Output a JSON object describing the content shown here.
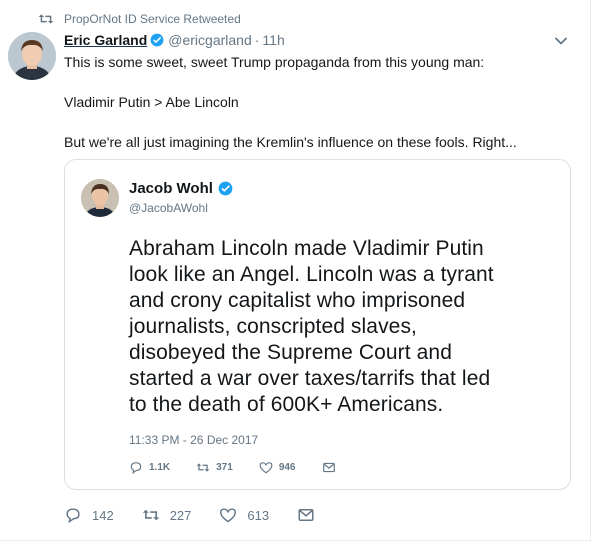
{
  "retweet_context": {
    "text": "PropOrNot ID Service Retweeted",
    "icon": "retweet-icon"
  },
  "tweet": {
    "display_name": "Eric Garland",
    "handle": "@ericgarland",
    "separator": "·",
    "time": "11h",
    "verified_icon": "verified-badge-icon",
    "text_lines": [
      "This is some sweet, sweet Trump propaganda from this young man:",
      "Vladimir Putin > Abe Lincoln",
      "But we're all just imagining the Kremlin's influence on these fools. Right..."
    ]
  },
  "quoted_tweet": {
    "display_name": "Jacob Wohl",
    "handle": "@JacobAWohl",
    "text_lines": [
      "Abraham Lincoln made Vladimir Putin",
      "look like an Angel. Lincoln was a tyrant",
      "and crony capitalist who imprisoned",
      "journalists, conscripted slaves,",
      "disobeyed the Supreme Court and",
      "started a war over taxes/tarrifs that led",
      "to the death of 600K+ Americans."
    ],
    "timestamp": "11:33 PM - 26 Dec 2017",
    "actions": {
      "reply_count": "1.1K",
      "retweet_count": "371",
      "like_count": "946"
    }
  },
  "actions": {
    "reply_count": "142",
    "retweet_count": "227",
    "like_count": "613"
  },
  "colors": {
    "text": "#14171a",
    "secondary": "#657786",
    "verified": "#1da1f2",
    "border": "#e6ecf0"
  }
}
